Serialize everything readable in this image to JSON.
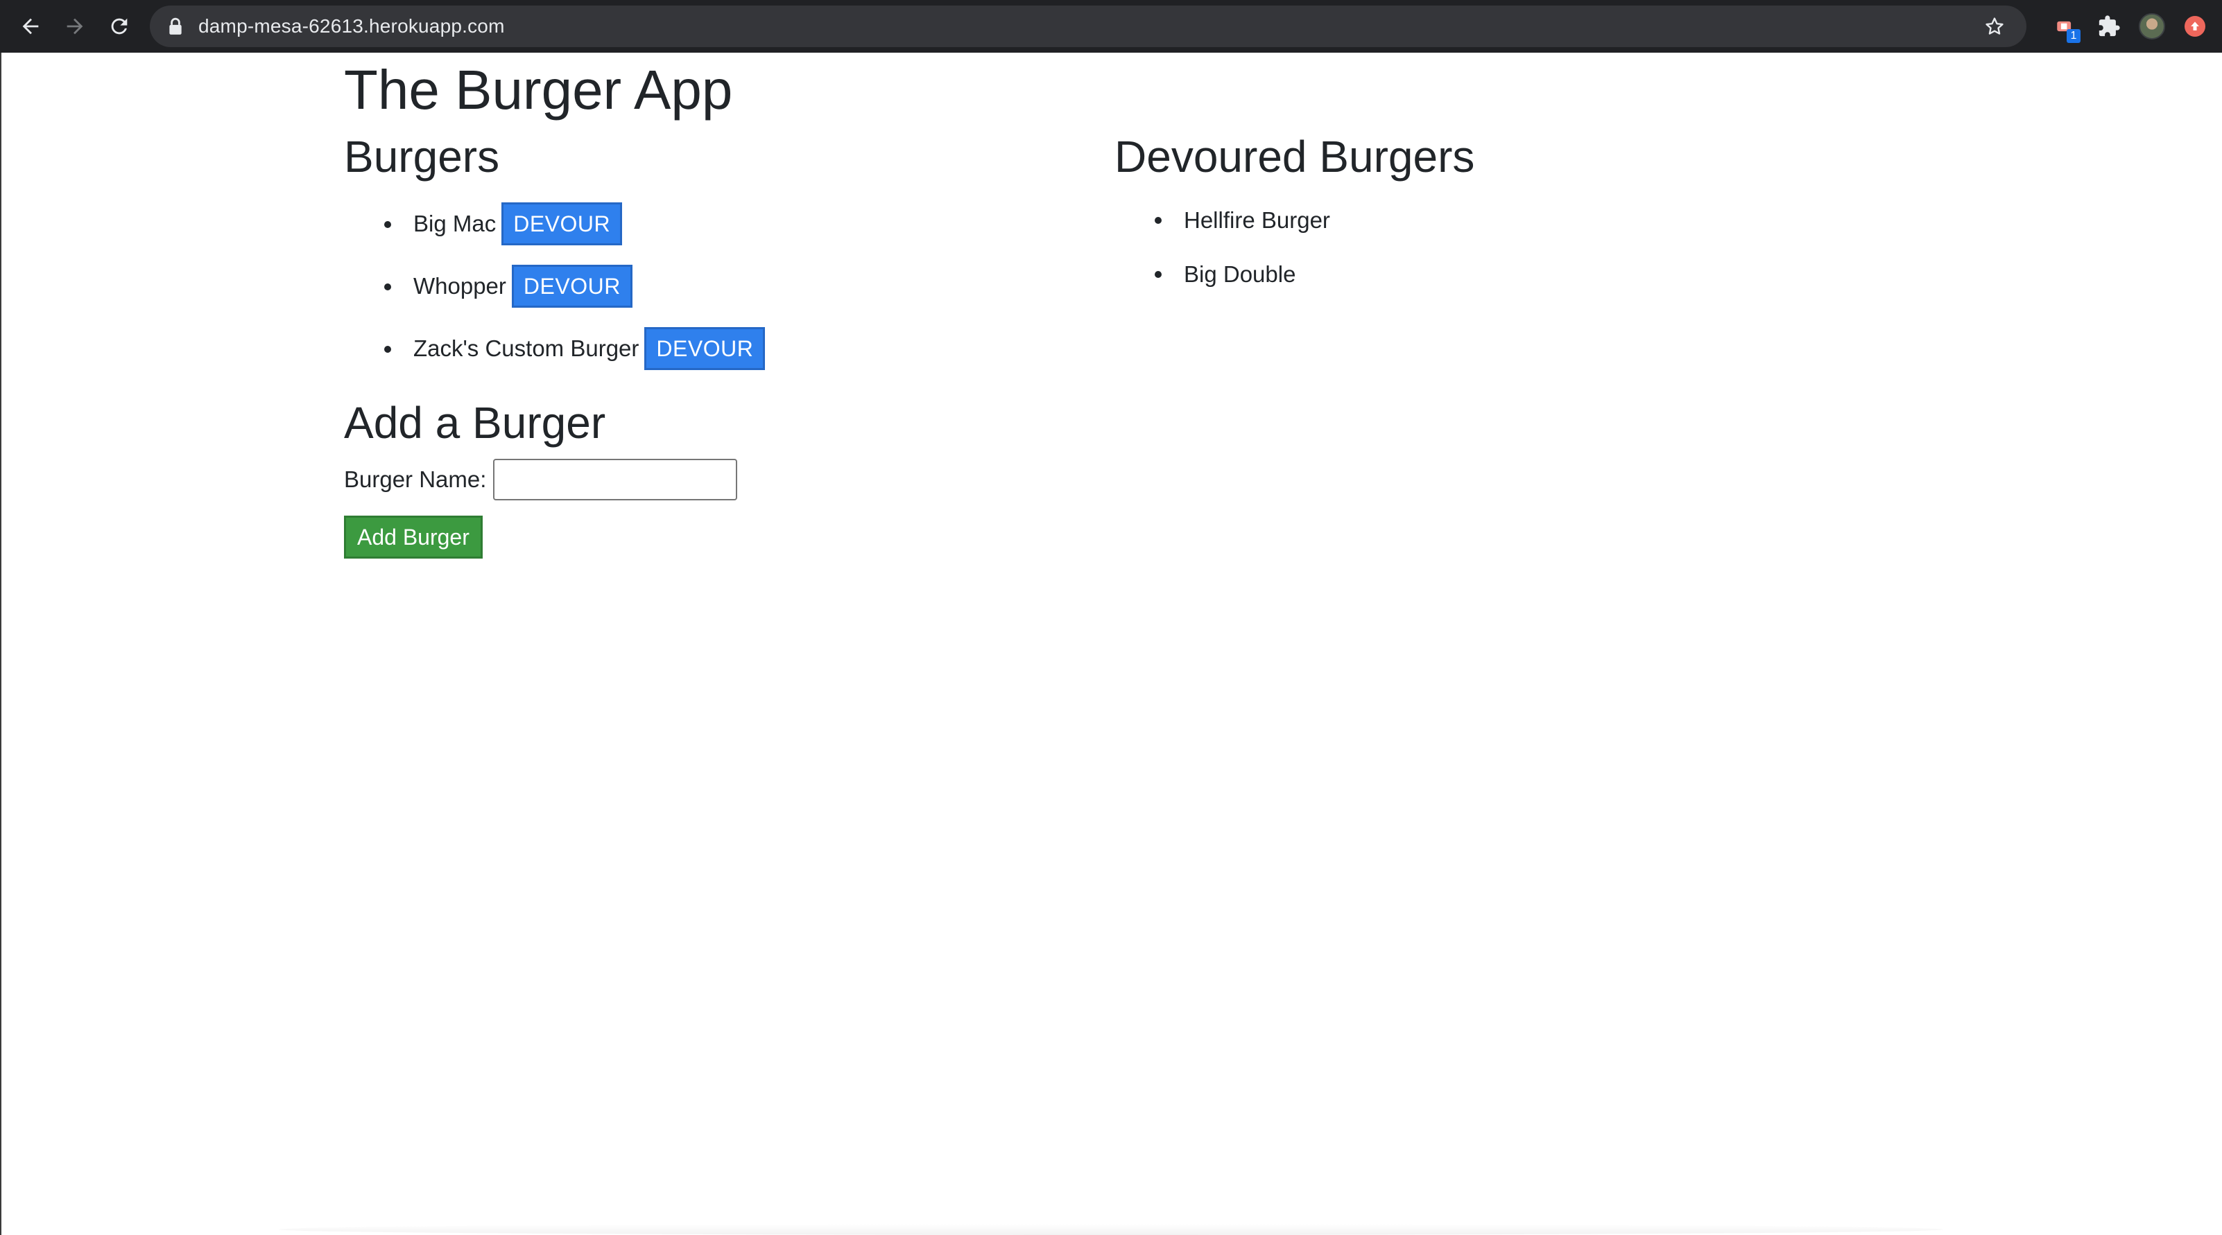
{
  "browser": {
    "url": "damp-mesa-62613.herokuapp.com",
    "extension_badge": "1",
    "icons": {
      "back": "back-arrow-icon",
      "forward": "forward-arrow-icon",
      "reload": "reload-icon",
      "lock": "lock-icon",
      "bookmark": "star-icon",
      "extension": "extension-icon",
      "extensions_menu": "puzzle-icon",
      "profile": "avatar",
      "update": "update-icon"
    }
  },
  "page": {
    "title": "The Burger App",
    "burgers": {
      "heading": "Burgers",
      "items": [
        {
          "name": "Big Mac",
          "button": "DEVOUR"
        },
        {
          "name": "Whopper",
          "button": "DEVOUR"
        },
        {
          "name": "Zack's Custom Burger",
          "button": "DEVOUR"
        }
      ]
    },
    "devoured": {
      "heading": "Devoured Burgers",
      "items": [
        {
          "name": "Hellfire Burger"
        },
        {
          "name": "Big Double"
        }
      ]
    },
    "add_form": {
      "heading": "Add a Burger",
      "label": "Burger Name:",
      "input_value": "",
      "submit_label": "Add Burger"
    }
  },
  "colors": {
    "devour_button": "#2f80ed",
    "add_button": "#3c9a40",
    "chrome_bg": "#202124",
    "omnibox_bg": "#35363a"
  }
}
